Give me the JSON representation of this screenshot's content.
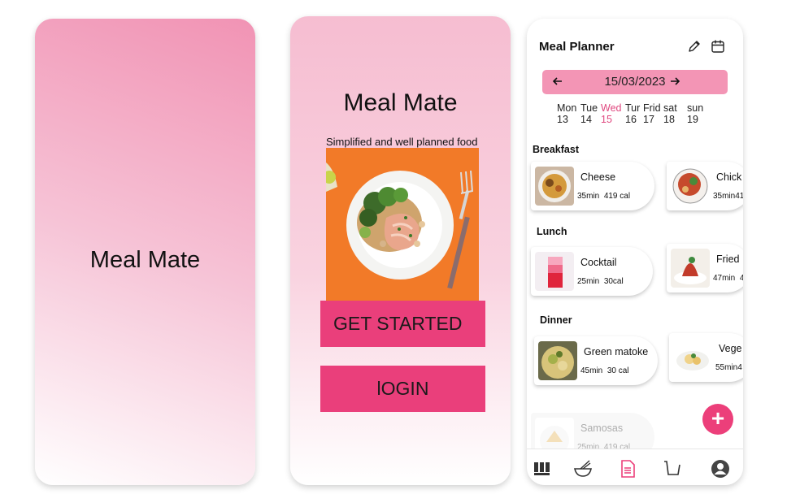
{
  "splash": {
    "title": "Meal Mate"
  },
  "welcome": {
    "title": "Meal Mate",
    "subtitle": "Simplified and well planned food",
    "get_started_label": "GET STARTED",
    "login_label": "lOGIN"
  },
  "planner": {
    "title": "Meal Planner",
    "date": "15/03/2023",
    "week": [
      {
        "name": "Mon",
        "num": "13"
      },
      {
        "name": "Tue",
        "num": "14"
      },
      {
        "name": "Wed",
        "num": "15"
      },
      {
        "name": "Tur",
        "num": "16"
      },
      {
        "name": "Frid",
        "num": "17"
      },
      {
        "name": "sat",
        "num": "18"
      },
      {
        "name": "sun",
        "num": "19"
      }
    ],
    "selected_day": "Wed",
    "sections": {
      "breakfast": "Breakfast",
      "lunch": "Lunch",
      "dinner": "Dinner"
    },
    "breakfast": [
      {
        "name": "Cheese",
        "time": "35min",
        "cal": "419 cal"
      },
      {
        "name": "Chick",
        "time": "35min",
        "cal": "41"
      }
    ],
    "lunch": [
      {
        "name": "Cocktail",
        "time": "25min",
        "cal": "30cal"
      },
      {
        "name": "Fried",
        "time": "47min",
        "cal": "4"
      }
    ],
    "dinner": [
      {
        "name": "Green matoke",
        "time": "45min",
        "cal": "30 cal"
      },
      {
        "name": "Vege",
        "time": "55min",
        "cal": "4"
      }
    ],
    "extra": {
      "name": "Samosas",
      "time": "25min",
      "cal": "419 cal"
    },
    "fab_label": "+",
    "nav": [
      "grid-icon",
      "bowl-whisk-icon",
      "document-icon",
      "cart-icon",
      "profile-icon"
    ],
    "accent_color": "#ec3f7a"
  }
}
